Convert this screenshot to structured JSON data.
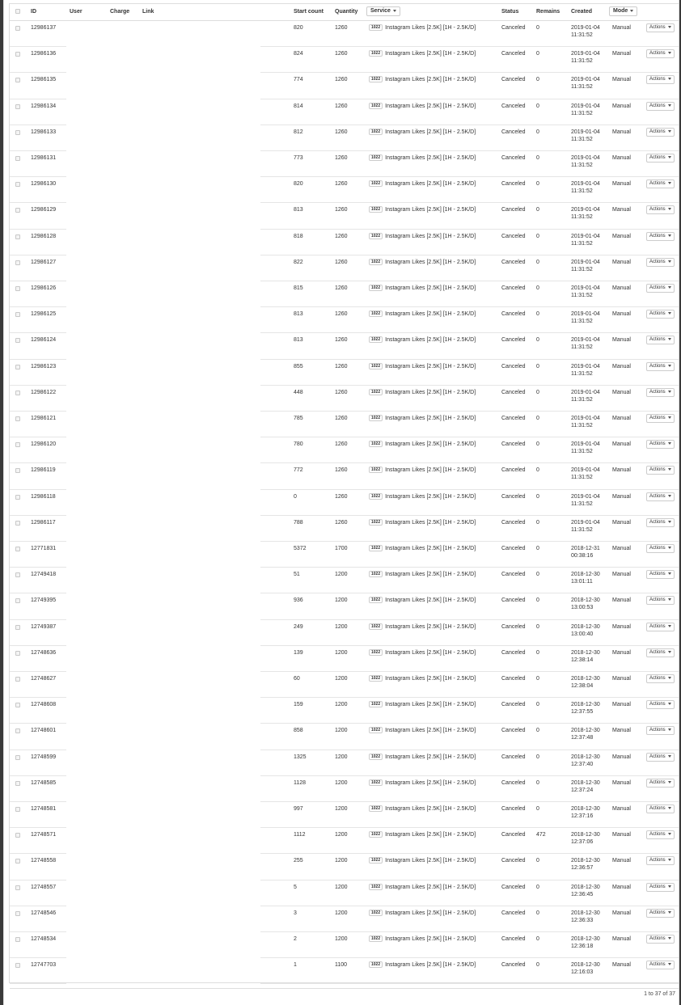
{
  "header": {
    "id": "ID",
    "user": "User",
    "charge": "Charge",
    "link": "Link",
    "start_count": "Start count",
    "quantity": "Quantity",
    "service": "Service",
    "status": "Status",
    "remains": "Remains",
    "created": "Created",
    "mode": "Mode"
  },
  "service_id": "1022",
  "service_name": "Instagram Likes [2.5K] [1H - 2.5K/D]",
  "actions_label": "Actions",
  "rows": [
    {
      "id": "12986137",
      "start": "820",
      "qty": "1260",
      "status": "Canceled",
      "remains": "0",
      "date": "2019-01-04",
      "time": "11:31:52",
      "mode": "Manual"
    },
    {
      "id": "12986136",
      "start": "824",
      "qty": "1260",
      "status": "Canceled",
      "remains": "0",
      "date": "2019-01-04",
      "time": "11:31:52",
      "mode": "Manual"
    },
    {
      "id": "12986135",
      "start": "774",
      "qty": "1260",
      "status": "Canceled",
      "remains": "0",
      "date": "2019-01-04",
      "time": "11:31:52",
      "mode": "Manual"
    },
    {
      "id": "12986134",
      "start": "814",
      "qty": "1260",
      "status": "Canceled",
      "remains": "0",
      "date": "2019-01-04",
      "time": "11:31:52",
      "mode": "Manual"
    },
    {
      "id": "12986133",
      "start": "812",
      "qty": "1260",
      "status": "Canceled",
      "remains": "0",
      "date": "2019-01-04",
      "time": "11:31:52",
      "mode": "Manual"
    },
    {
      "id": "12986131",
      "start": "773",
      "qty": "1260",
      "status": "Canceled",
      "remains": "0",
      "date": "2019-01-04",
      "time": "11:31:52",
      "mode": "Manual"
    },
    {
      "id": "12986130",
      "start": "820",
      "qty": "1260",
      "status": "Canceled",
      "remains": "0",
      "date": "2019-01-04",
      "time": "11:31:52",
      "mode": "Manual"
    },
    {
      "id": "12986129",
      "start": "813",
      "qty": "1260",
      "status": "Canceled",
      "remains": "0",
      "date": "2019-01-04",
      "time": "11:31:52",
      "mode": "Manual"
    },
    {
      "id": "12986128",
      "start": "818",
      "qty": "1260",
      "status": "Canceled",
      "remains": "0",
      "date": "2019-01-04",
      "time": "11:31:52",
      "mode": "Manual"
    },
    {
      "id": "12986127",
      "start": "822",
      "qty": "1260",
      "status": "Canceled",
      "remains": "0",
      "date": "2019-01-04",
      "time": "11:31:52",
      "mode": "Manual"
    },
    {
      "id": "12986126",
      "start": "815",
      "qty": "1260",
      "status": "Canceled",
      "remains": "0",
      "date": "2019-01-04",
      "time": "11:31:52",
      "mode": "Manual"
    },
    {
      "id": "12986125",
      "start": "813",
      "qty": "1260",
      "status": "Canceled",
      "remains": "0",
      "date": "2019-01-04",
      "time": "11:31:52",
      "mode": "Manual"
    },
    {
      "id": "12986124",
      "start": "813",
      "qty": "1260",
      "status": "Canceled",
      "remains": "0",
      "date": "2019-01-04",
      "time": "11:31:52",
      "mode": "Manual"
    },
    {
      "id": "12986123",
      "start": "855",
      "qty": "1260",
      "status": "Canceled",
      "remains": "0",
      "date": "2019-01-04",
      "time": "11:31:52",
      "mode": "Manual"
    },
    {
      "id": "12986122",
      "start": "448",
      "qty": "1260",
      "status": "Canceled",
      "remains": "0",
      "date": "2019-01-04",
      "time": "11:31:52",
      "mode": "Manual"
    },
    {
      "id": "12986121",
      "start": "785",
      "qty": "1260",
      "status": "Canceled",
      "remains": "0",
      "date": "2019-01-04",
      "time": "11:31:52",
      "mode": "Manual"
    },
    {
      "id": "12986120",
      "start": "780",
      "qty": "1260",
      "status": "Canceled",
      "remains": "0",
      "date": "2019-01-04",
      "time": "11:31:52",
      "mode": "Manual"
    },
    {
      "id": "12986119",
      "start": "772",
      "qty": "1260",
      "status": "Canceled",
      "remains": "0",
      "date": "2019-01-04",
      "time": "11:31:52",
      "mode": "Manual"
    },
    {
      "id": "12986118",
      "start": "0",
      "qty": "1260",
      "status": "Canceled",
      "remains": "0",
      "date": "2019-01-04",
      "time": "11:31:52",
      "mode": "Manual"
    },
    {
      "id": "12986117",
      "start": "788",
      "qty": "1260",
      "status": "Canceled",
      "remains": "0",
      "date": "2019-01-04",
      "time": "11:31:52",
      "mode": "Manual"
    },
    {
      "id": "12771831",
      "start": "5372",
      "qty": "1700",
      "status": "Canceled",
      "remains": "0",
      "date": "2018-12-31",
      "time": "00:38:16",
      "mode": "Manual"
    },
    {
      "id": "12749418",
      "start": "51",
      "qty": "1200",
      "status": "Canceled",
      "remains": "0",
      "date": "2018-12-30",
      "time": "13:01:11",
      "mode": "Manual"
    },
    {
      "id": "12749395",
      "start": "936",
      "qty": "1200",
      "status": "Canceled",
      "remains": "0",
      "date": "2018-12-30",
      "time": "13:00:53",
      "mode": "Manual"
    },
    {
      "id": "12749387",
      "start": "249",
      "qty": "1200",
      "status": "Canceled",
      "remains": "0",
      "date": "2018-12-30",
      "time": "13:00:40",
      "mode": "Manual"
    },
    {
      "id": "12748636",
      "start": "139",
      "qty": "1200",
      "status": "Canceled",
      "remains": "0",
      "date": "2018-12-30",
      "time": "12:38:14",
      "mode": "Manual"
    },
    {
      "id": "12748627",
      "start": "60",
      "qty": "1200",
      "status": "Canceled",
      "remains": "0",
      "date": "2018-12-30",
      "time": "12:38:04",
      "mode": "Manual"
    },
    {
      "id": "12748608",
      "start": "159",
      "qty": "1200",
      "status": "Canceled",
      "remains": "0",
      "date": "2018-12-30",
      "time": "12:37:55",
      "mode": "Manual"
    },
    {
      "id": "12748601",
      "start": "858",
      "qty": "1200",
      "status": "Canceled",
      "remains": "0",
      "date": "2018-12-30",
      "time": "12:37:48",
      "mode": "Manual"
    },
    {
      "id": "12748599",
      "start": "1325",
      "qty": "1200",
      "status": "Canceled",
      "remains": "0",
      "date": "2018-12-30",
      "time": "12:37:40",
      "mode": "Manual"
    },
    {
      "id": "12748585",
      "start": "1128",
      "qty": "1200",
      "status": "Canceled",
      "remains": "0",
      "date": "2018-12-30",
      "time": "12:37:24",
      "mode": "Manual"
    },
    {
      "id": "12748581",
      "start": "997",
      "qty": "1200",
      "status": "Canceled",
      "remains": "0",
      "date": "2018-12-30",
      "time": "12:37:16",
      "mode": "Manual"
    },
    {
      "id": "12748571",
      "start": "1112",
      "qty": "1200",
      "status": "Canceled",
      "remains": "472",
      "date": "2018-12-30",
      "time": "12:37:06",
      "mode": "Manual"
    },
    {
      "id": "12748558",
      "start": "255",
      "qty": "1200",
      "status": "Canceled",
      "remains": "0",
      "date": "2018-12-30",
      "time": "12:36:57",
      "mode": "Manual"
    },
    {
      "id": "12748557",
      "start": "5",
      "qty": "1200",
      "status": "Canceled",
      "remains": "0",
      "date": "2018-12-30",
      "time": "12:36:45",
      "mode": "Manual"
    },
    {
      "id": "12748546",
      "start": "3",
      "qty": "1200",
      "status": "Canceled",
      "remains": "0",
      "date": "2018-12-30",
      "time": "12:36:33",
      "mode": "Manual"
    },
    {
      "id": "12748534",
      "start": "2",
      "qty": "1200",
      "status": "Canceled",
      "remains": "0",
      "date": "2018-12-30",
      "time": "12:36:18",
      "mode": "Manual"
    },
    {
      "id": "12747703",
      "start": "1",
      "qty": "1100",
      "status": "Canceled",
      "remains": "0",
      "date": "2018-12-30",
      "time": "12:16:03",
      "mode": "Manual"
    }
  ],
  "pagination": "1 to 37 of 37"
}
